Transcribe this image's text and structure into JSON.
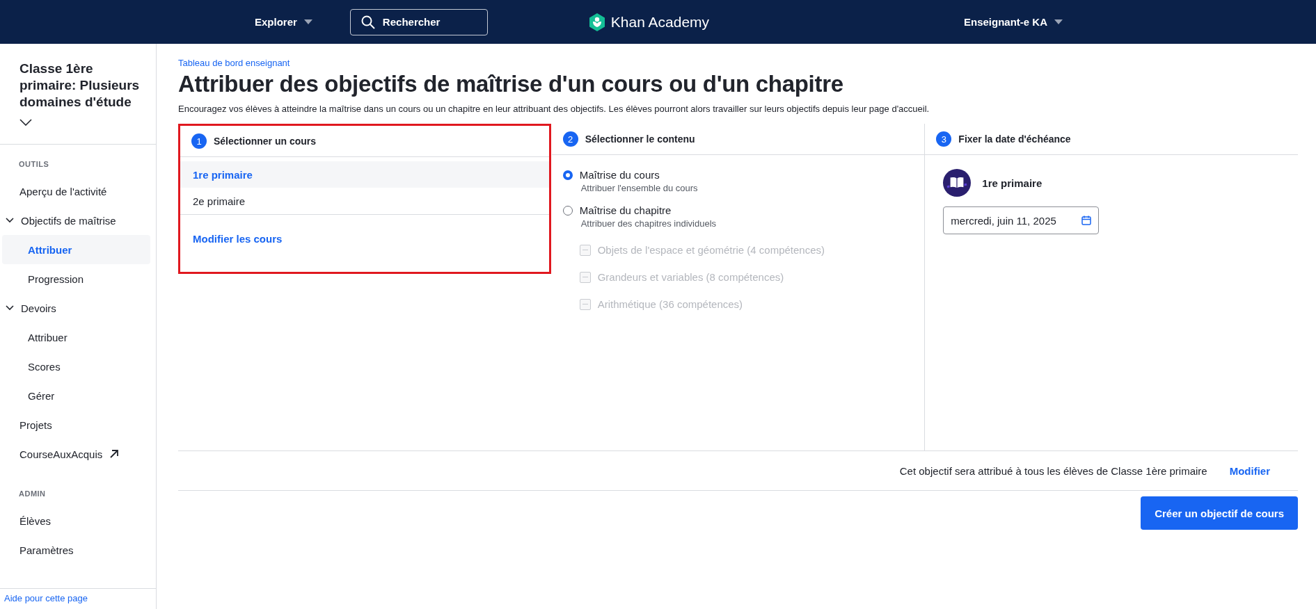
{
  "header": {
    "explore": "Explorer",
    "search": {
      "placeholder": "Rechercher"
    },
    "logo": "Khan Academy",
    "account": "Enseignant-e KA"
  },
  "sidebar": {
    "class_name": "Classe 1ère primaire: Plusieurs domaines d'étude",
    "sections": [
      {
        "label": "OUTILS",
        "items": [
          {
            "label": "Aperçu de l'activité",
            "kind": "link",
            "selected": false
          },
          {
            "label": "Objectifs de maîtrise",
            "kind": "group",
            "expanded": true,
            "children": [
              {
                "label": "Attribuer",
                "selected": true
              },
              {
                "label": "Progression",
                "selected": false
              }
            ]
          },
          {
            "label": "Devoirs",
            "kind": "group",
            "expanded": true,
            "children": [
              {
                "label": "Attribuer",
                "selected": false
              },
              {
                "label": "Scores",
                "selected": false
              },
              {
                "label": "Gérer",
                "selected": false
              }
            ]
          },
          {
            "label": "Projets",
            "kind": "link",
            "selected": false
          },
          {
            "label": "CourseAuxAcquis",
            "kind": "external",
            "selected": false
          }
        ]
      },
      {
        "label": "ADMIN",
        "items": [
          {
            "label": "Élèves",
            "kind": "link",
            "selected": false
          },
          {
            "label": "Paramètres",
            "kind": "link",
            "selected": false
          }
        ]
      }
    ],
    "help": "Aide pour cette page"
  },
  "breadcrumb": "Tableau de bord enseignant",
  "title": "Attribuer des objectifs de maîtrise d'un cours ou d'un chapitre",
  "description": "Encouragez vos élèves à atteindre la maîtrise dans un cours ou un chapitre en leur attribuant des objectifs. Les élèves pourront alors travailler sur leurs objectifs depuis leur page d'accueil.",
  "steps": [
    {
      "number": "1",
      "title": "Sélectionner un cours",
      "highlighted": true
    },
    {
      "number": "2",
      "title": "Sélectionner le contenu",
      "highlighted": false
    },
    {
      "number": "3",
      "title": "Fixer la date d'échéance",
      "highlighted": false
    }
  ],
  "courses": [
    {
      "label": "1re primaire",
      "selected": true
    },
    {
      "label": "2e primaire",
      "selected": false
    }
  ],
  "edit_courses": "Modifier les cours",
  "content_options": [
    {
      "label": "Maîtrise du cours",
      "hint": "Attribuer l'ensemble du cours",
      "selected": true
    },
    {
      "label": "Maîtrise du chapitre",
      "hint": "Attribuer des chapitres individuels",
      "selected": false,
      "chapters": [
        {
          "label": "Objets de l'espace et géométrie (4 compétences)",
          "disabled": true
        },
        {
          "label": "Grandeurs et variables (8 compétences)",
          "disabled": true
        },
        {
          "label": "Arithmétique (36 compétences)",
          "disabled": true
        }
      ]
    }
  ],
  "due": {
    "course": "1re primaire",
    "date": "mercredi, juin 11, 2025"
  },
  "footer": {
    "note": "Cet objectif sera attribué à tous les élèves de Classe 1ère primaire",
    "edit": "Modifier",
    "submit": "Créer un objectif de cours"
  }
}
